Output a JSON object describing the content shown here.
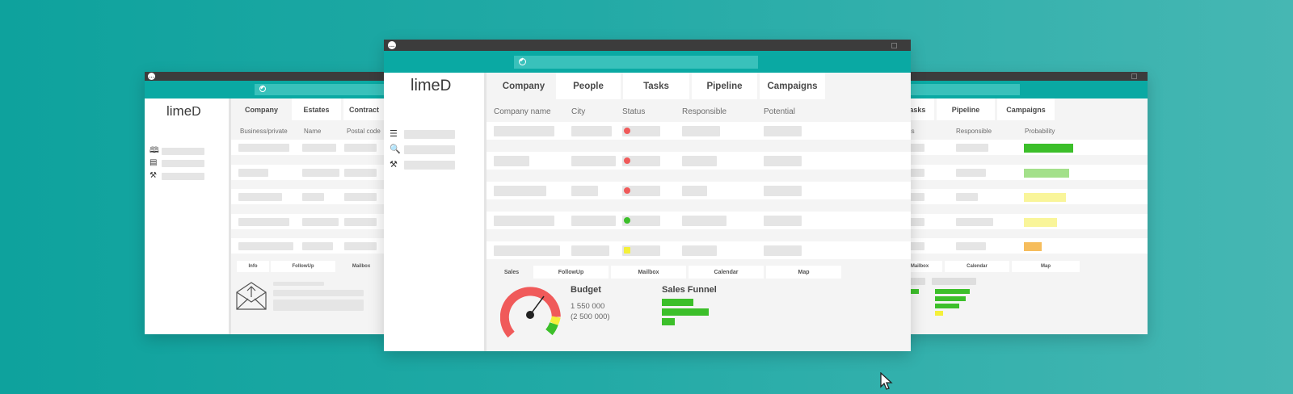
{
  "colors": {
    "accent": "#0aa9a3",
    "titlebar": "#3c3c3c",
    "status_red": "#f05a5a",
    "status_green": "#3cbf2a",
    "status_yellow": "#f4f03a",
    "prob_dark_green": "#3cbf2a",
    "prob_light_green": "#a3e08a",
    "prob_yellow": "#f9f59a",
    "prob_orange": "#f6bd5c"
  },
  "left_window": {
    "logo": "lime",
    "tabs": [
      "Company",
      "Estates",
      "Contract"
    ],
    "columns": [
      "Business/private",
      "Name",
      "Postal code"
    ],
    "bottom_tabs": [
      "Info",
      "FollowUp",
      "Mailbox"
    ]
  },
  "center_window": {
    "logo": "lime",
    "tabs": [
      "Company",
      "People",
      "Tasks",
      "Pipeline",
      "Campaigns"
    ],
    "columns": [
      "Company name",
      "City",
      "Status",
      "Responsible",
      "Potential"
    ],
    "row_status": [
      "red",
      "red",
      "red",
      "green",
      "yellow"
    ],
    "bottom_tabs": [
      "Sales",
      "FollowUp",
      "Mailbox",
      "Calendar",
      "Map"
    ],
    "budget": {
      "title": "Budget",
      "value": "1 550 000",
      "target": "(2 500 000)"
    },
    "sales_funnel": {
      "title": "Sales Funnel",
      "bars": [
        0.68,
        1.0,
        0.27
      ]
    }
  },
  "right_window": {
    "tabs": [
      "Tasks",
      "Pipeline",
      "Campaigns"
    ],
    "columns": [
      "Status",
      "Responsible",
      "Probability"
    ],
    "probability_levels": [
      "dark-green",
      "light-green",
      "yellow",
      "yellow",
      "orange"
    ],
    "bottom_tabs": [
      "Mailbox",
      "Calendar",
      "Map"
    ],
    "funnel_bars": [
      1.0,
      0.9,
      0.7,
      0.25
    ]
  }
}
